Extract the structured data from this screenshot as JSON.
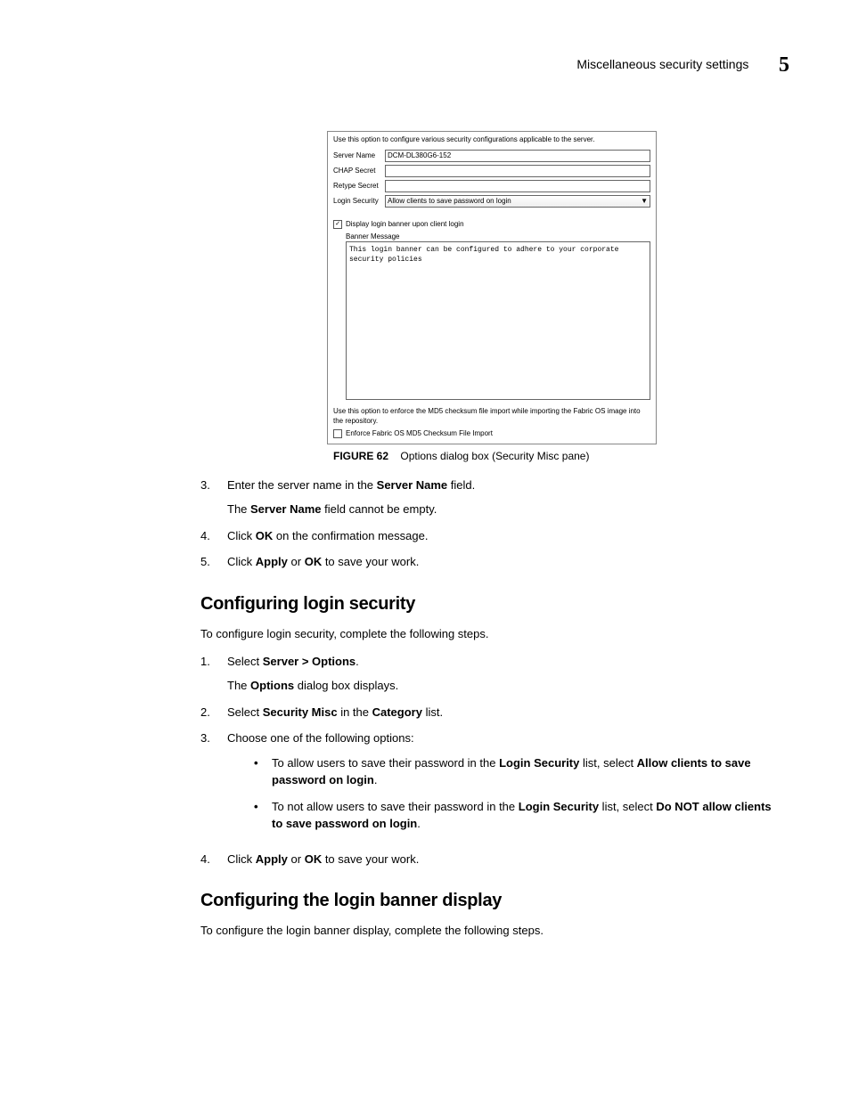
{
  "header": {
    "title": "Miscellaneous security settings",
    "chapter": "5"
  },
  "screenshot": {
    "intro": "Use this option to configure various security configurations applicable to the server.",
    "rows": {
      "server_name_label": "Server Name",
      "server_name_value": "DCM-DL380G6-152",
      "chap_secret_label": "CHAP Secret",
      "retype_secret_label": "Retype Secret",
      "login_security_label": "Login Security",
      "login_security_value": "Allow clients to save password on login"
    },
    "checkbox_display_label": "Display login banner upon client login",
    "banner_message_label": "Banner Message",
    "banner_message_text": "This login banner can be configured to adhere to your corporate security policies",
    "footer_text": "Use this option to enforce the MD5 checksum file import while importing the Fabric OS image into the repository.",
    "checkbox_enforce_label": "Enforce Fabric OS MD5 Checksum File Import"
  },
  "figure": {
    "label": "FIGURE 62",
    "caption": "Options dialog box (Security Misc pane)"
  },
  "steps_a": {
    "s3_num": "3.",
    "s3_text_a": "Enter the server name in the ",
    "s3_bold": "Server Name",
    "s3_text_b": " field.",
    "s3_sub_a": "The ",
    "s3_sub_bold": "Server Name",
    "s3_sub_b": " field cannot be empty.",
    "s4_num": "4.",
    "s4_text_a": "Click ",
    "s4_bold": "OK",
    "s4_text_b": " on the confirmation message.",
    "s5_num": "5.",
    "s5_text_a": "Click ",
    "s5_bold_a": "Apply",
    "s5_text_b": " or ",
    "s5_bold_b": "OK",
    "s5_text_c": " to save your work."
  },
  "section1": {
    "heading": "Configuring login security",
    "intro": "To configure login security, complete the following steps.",
    "s1_num": "1.",
    "s1_text_a": "Select ",
    "s1_bold": "Server > Options",
    "s1_text_b": ".",
    "s1_sub_a": "The ",
    "s1_sub_bold": "Options",
    "s1_sub_b": " dialog box displays.",
    "s2_num": "2.",
    "s2_text_a": "Select ",
    "s2_bold_a": "Security Misc",
    "s2_text_b": " in the ",
    "s2_bold_b": "Category",
    "s2_text_c": " list.",
    "s3_num": "3.",
    "s3_text": "Choose one of the following options:",
    "b1_a": "To allow users to save their password in the ",
    "b1_bold_a": "Login Security",
    "b1_b": " list, select ",
    "b1_bold_b": "Allow clients to save password on login",
    "b1_c": ".",
    "b2_a": "To not allow users to save their password in the ",
    "b2_bold_a": "Login Security",
    "b2_b": " list, select ",
    "b2_bold_b": "Do NOT allow clients to save password on login",
    "b2_c": ".",
    "s4_num": "4.",
    "s4_text_a": "Click ",
    "s4_bold_a": "Apply",
    "s4_text_b": " or ",
    "s4_bold_b": "OK",
    "s4_text_c": " to save your work."
  },
  "section2": {
    "heading": "Configuring the login banner display",
    "intro": "To configure the login banner display, complete the following steps."
  }
}
